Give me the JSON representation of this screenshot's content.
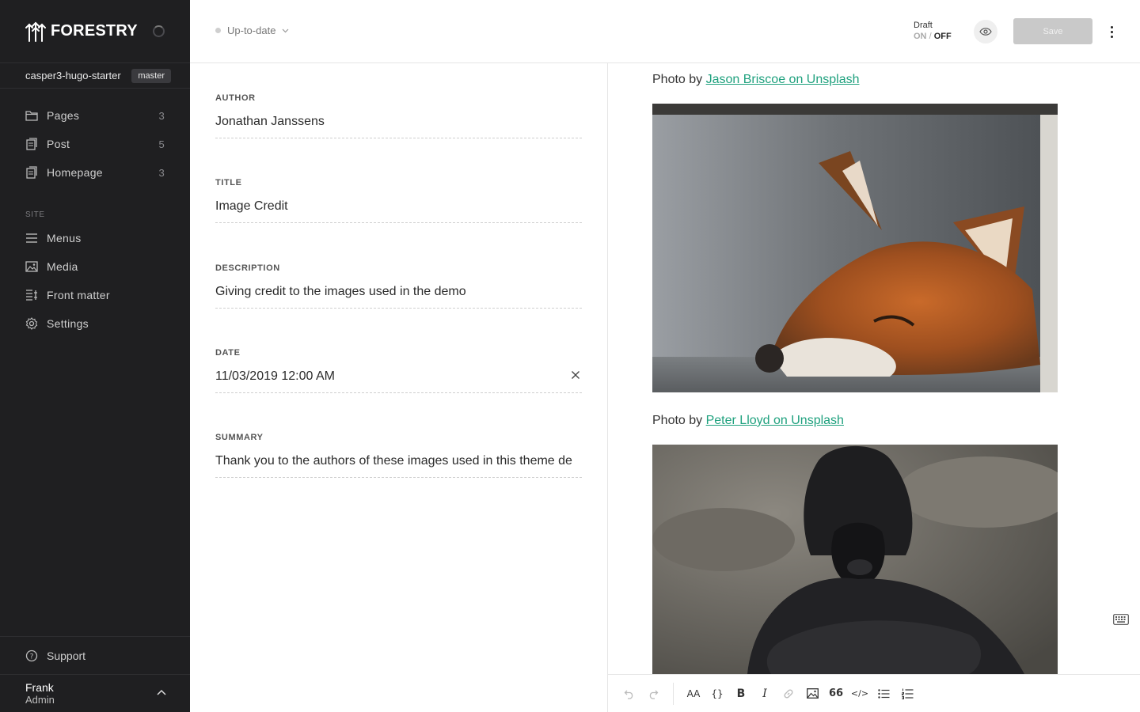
{
  "brand": {
    "name": "FORESTRY"
  },
  "repo": {
    "name": "casper3-hugo-starter",
    "branch": "master"
  },
  "nav": {
    "items": [
      {
        "label": "Pages",
        "count": "3"
      },
      {
        "label": "Post",
        "count": "5"
      },
      {
        "label": "Homepage",
        "count": "3"
      }
    ],
    "site_label": "SITE",
    "site_items": [
      {
        "label": "Menus"
      },
      {
        "label": "Media"
      },
      {
        "label": "Front matter"
      },
      {
        "label": "Settings"
      }
    ],
    "support": "Support"
  },
  "user": {
    "name": "Frank",
    "role": "Admin"
  },
  "topbar": {
    "status": "Up-to-date",
    "draft_label": "Draft",
    "draft_on": "ON",
    "draft_sep": "/",
    "draft_off": "OFF",
    "save_label": "Save"
  },
  "front_matter": {
    "fields": [
      {
        "label": "AUTHOR",
        "value": "Jonathan Janssens"
      },
      {
        "label": "TITLE",
        "value": "Image Credit"
      },
      {
        "label": "DESCRIPTION",
        "value": "Giving credit to the images used in the demo"
      },
      {
        "label": "DATE",
        "value": "11/03/2019 12:00 AM"
      },
      {
        "label": "SUMMARY",
        "value": "Thank you to the authors of these images used in this theme de"
      }
    ]
  },
  "body": {
    "captions": [
      {
        "prefix": "Photo by ",
        "link": "Jason Briscoe on Unsplash"
      },
      {
        "prefix": "Photo by ",
        "link": "Peter Lloyd on Unsplash"
      }
    ]
  },
  "toolbar": {
    "heading_glyph": "AA",
    "code_block_glyph": "{}",
    "bold_glyph": "B",
    "italic_glyph": "I",
    "quote_glyph": "66",
    "code_glyph": "</>"
  },
  "colors": {
    "sidebar_bg": "#1f1f21",
    "link": "#1fa17e",
    "save_disabled": "#c9c9c9"
  }
}
